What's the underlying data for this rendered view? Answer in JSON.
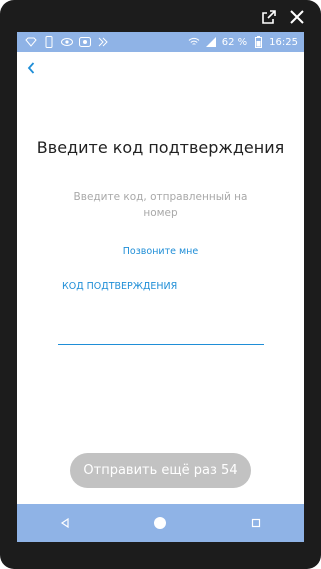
{
  "status_bar": {
    "battery_text": "62 %",
    "time": "16:25",
    "icons": [
      "diamond-icon",
      "phone-icon",
      "eye-icon",
      "screen-record-icon",
      "bolt-icon",
      "wifi-icon",
      "signal-icon",
      "battery-icon"
    ]
  },
  "frame": {
    "controls": [
      "external-link-icon",
      "close-icon"
    ]
  },
  "content": {
    "title": "Введите код подтверждения",
    "subtitle": "Введите код, отправленный на номер",
    "call_link": "Позвоните мне",
    "field_label": "КОД ПОДТВЕРЖДЕНИЯ",
    "code_value": "",
    "resend_label": "Отправить ещё раз 54"
  },
  "colors": {
    "accent": "#1f8ed7",
    "bar": "#8fb3e6",
    "button_disabled": "#c2c2c2"
  }
}
